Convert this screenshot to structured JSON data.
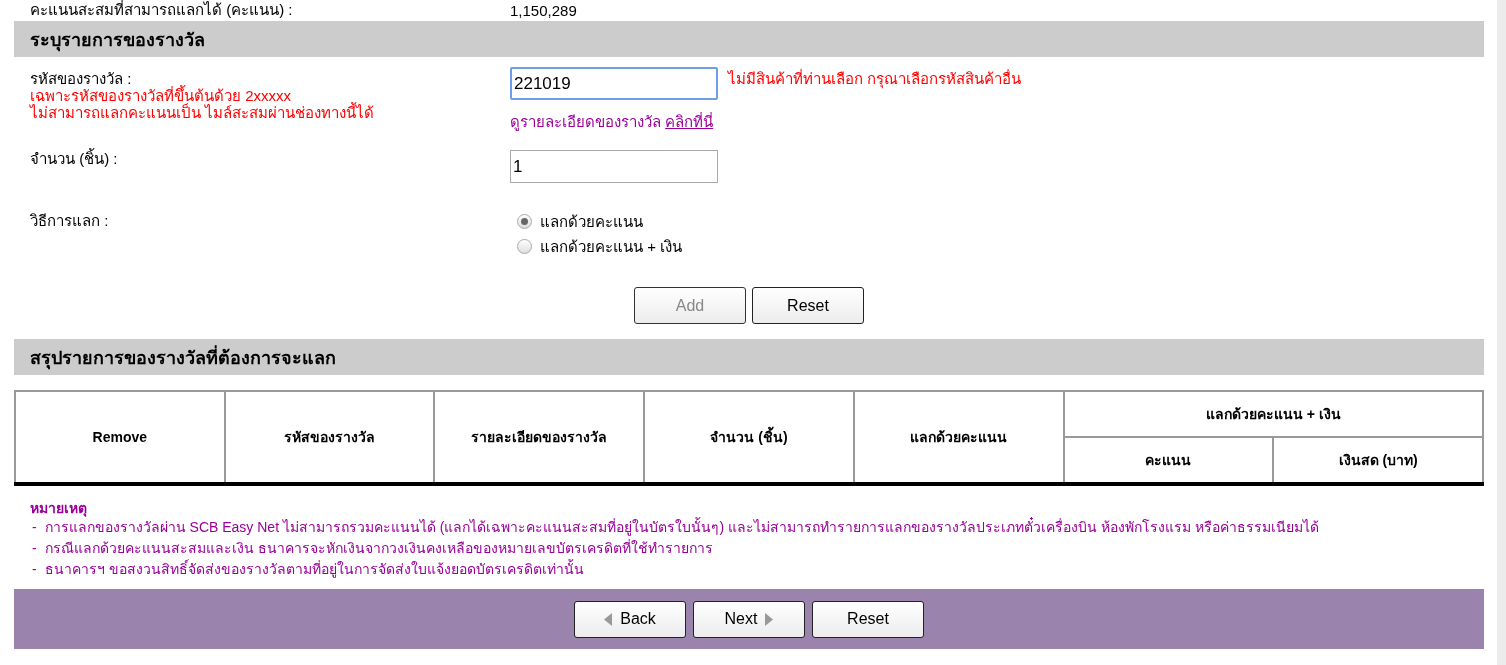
{
  "points_line": {
    "label": "คะแนนสะสมที่สามารถแลกได้ (คะแนน) :",
    "value": "1,150,289"
  },
  "prize_section": {
    "title": "ระบุรายการของรางวัล",
    "code_field": {
      "label": "รหัสของรางวัล :",
      "hints": [
        "เฉพาะรหัสของรางวัลที่ขึ้นต้นด้วย 2xxxxx",
        "ไม่สามารถแลกคะแนนเป็น ไมล์สะสมผ่านช่องทางนี้ได้"
      ],
      "value": "221019",
      "focused": true,
      "error": "ไม่มีสินค้าที่ท่านเลือก กรุณาเลือกรหัสสินค้าอื่น",
      "detail_text": "ดูรายละเอียดของรางวัล",
      "detail_link": "คลิกที่นี่"
    },
    "quantity_field": {
      "label": "จำนวน (ชิ้น) :",
      "value": "1",
      "focused": false
    },
    "method": {
      "label": "วิธีการแลก :",
      "options": [
        {
          "label": "แลกด้วยคะแนน",
          "selected": true
        },
        {
          "label": "แลกด้วยคะแนน + เงิน",
          "selected": false
        }
      ]
    },
    "buttons": [
      {
        "label": "Add",
        "disabled": true
      },
      {
        "label": "Reset",
        "disabled": false
      }
    ]
  },
  "summary_section": {
    "title": "สรุปรายการของรางวัลที่ต้องการจะแลก",
    "table": {
      "columns": [
        {
          "label": "Remove"
        },
        {
          "label": "รหัสของรางวัล"
        },
        {
          "label": "รายละเอียดของรางวัล"
        },
        {
          "label": "จำนวน (ชิ้น)"
        },
        {
          "label": "แลกด้วยคะแนน"
        },
        {
          "label": "แลกด้วยคะแนน + เงิน",
          "children": [
            {
              "label": "คะแนน"
            },
            {
              "label": "เงินสด (บาท)"
            }
          ]
        }
      ]
    }
  },
  "notes": {
    "title": "หมายเหตุ",
    "items": [
      {
        "marker": "-",
        "text": "การแลกของรางวัลผ่าน SCB Easy Net ไม่สามารถรวมคะแนนได้ (แลกได้เฉพาะคะแนนสะสมที่อยู่ในบัตรใบนั้นๆ) และไม่สามารถทำรายการแลกของรางวัลประเภทตั๋วเครื่องบิน ห้องพักโรงแรม หรือค่าธรรมเนียมได้"
      },
      {
        "marker": "-",
        "text": "กรณีแลกด้วยคะแนนสะสมและเงิน ธนาคารจะหักเงินจากวงเงินคงเหลือของหมายเลขบัตรเครดิตที่ใช้ทำรายการ"
      },
      {
        "marker": "-",
        "text": "ธนาคารฯ ขอสงวนสิทธิ์จัดส่งของรางวัลตามที่อยู่ในการจัดส่งใบแจ้งยอดบัตรเครดิตเท่านั้น"
      }
    ]
  },
  "footer_buttons": [
    {
      "label": "Back",
      "kind": "back"
    },
    {
      "label": "Next",
      "kind": "next"
    },
    {
      "label": "Reset",
      "kind": "plain"
    }
  ]
}
